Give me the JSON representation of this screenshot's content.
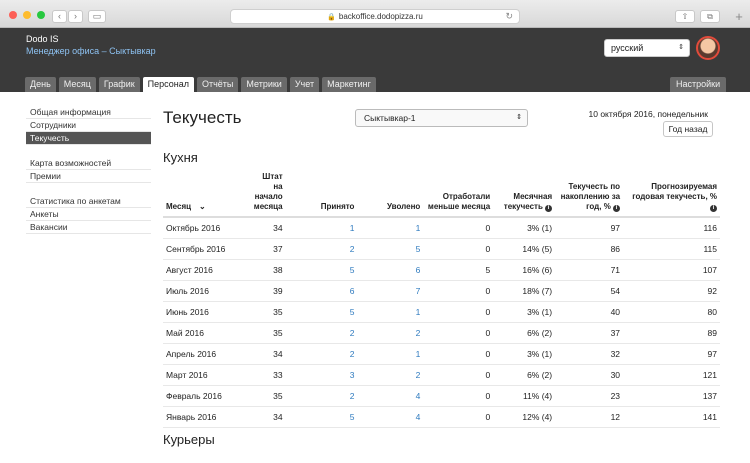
{
  "browser": {
    "url": "backoffice.dodopizza.ru"
  },
  "header": {
    "brand": "Dodo IS",
    "office": "Менеджер офиса – Сыктывкар",
    "language": "русский"
  },
  "tabs": [
    {
      "label": "День"
    },
    {
      "label": "Месяц"
    },
    {
      "label": "График"
    },
    {
      "label": "Персонал",
      "active": true
    },
    {
      "label": "Отчёты"
    },
    {
      "label": "Метрики"
    },
    {
      "label": "Учет"
    },
    {
      "label": "Маркетинг"
    }
  ],
  "settings_label": "Настройки",
  "sidebar": {
    "groups": [
      [
        "Общая информация",
        "Сотрудники",
        "Текучесть"
      ],
      [
        "Карта возможностей",
        "Премии"
      ],
      [
        "Статистика по анкетам",
        "Анкеты",
        "Вакансии"
      ]
    ]
  },
  "main": {
    "title": "Текучесть",
    "city": "Сыктывкар-1",
    "date": "10 октября 2016, понедельник",
    "back_label": "Год назад",
    "section_kitchen": "Кухня",
    "section_couriers": "Курьеры"
  },
  "table": {
    "headers": {
      "month": "Месяц",
      "staff": "Штат на начало месяца",
      "hired": "Принято",
      "fired": "Уволено",
      "worked_less": "Отработали меньше месяца",
      "monthly": "Месячная текучесть",
      "accumulated": "Текучесть по накоплению за год, %",
      "forecast": "Прогнозируемая годовая текучесть, %"
    },
    "rows": [
      {
        "month": "Октябрь 2016",
        "staff": "34",
        "hired": "1",
        "fired": "1",
        "less": "0",
        "monthly": "3% (1)",
        "acc": "97",
        "forecast": "116"
      },
      {
        "month": "Сентябрь 2016",
        "staff": "37",
        "hired": "2",
        "fired": "5",
        "less": "0",
        "monthly": "14% (5)",
        "acc": "86",
        "forecast": "115"
      },
      {
        "month": "Август 2016",
        "staff": "38",
        "hired": "5",
        "fired": "6",
        "less": "5",
        "monthly": "16% (6)",
        "acc": "71",
        "forecast": "107"
      },
      {
        "month": "Июль 2016",
        "staff": "39",
        "hired": "6",
        "fired": "7",
        "less": "0",
        "monthly": "18% (7)",
        "acc": "54",
        "forecast": "92"
      },
      {
        "month": "Июнь 2016",
        "staff": "35",
        "hired": "5",
        "fired": "1",
        "less": "0",
        "monthly": "3% (1)",
        "acc": "40",
        "forecast": "80"
      },
      {
        "month": "Май 2016",
        "staff": "35",
        "hired": "2",
        "fired": "2",
        "less": "0",
        "monthly": "6% (2)",
        "acc": "37",
        "forecast": "89"
      },
      {
        "month": "Апрель 2016",
        "staff": "34",
        "hired": "2",
        "fired": "1",
        "less": "0",
        "monthly": "3% (1)",
        "acc": "32",
        "forecast": "97"
      },
      {
        "month": "Март 2016",
        "staff": "33",
        "hired": "3",
        "fired": "2",
        "less": "0",
        "monthly": "6% (2)",
        "acc": "30",
        "forecast": "121"
      },
      {
        "month": "Февраль 2016",
        "staff": "35",
        "hired": "2",
        "fired": "4",
        "less": "0",
        "monthly": "11% (4)",
        "acc": "23",
        "forecast": "137"
      },
      {
        "month": "Январь 2016",
        "staff": "34",
        "hired": "5",
        "fired": "4",
        "less": "0",
        "monthly": "12% (4)",
        "acc": "12",
        "forecast": "141"
      }
    ]
  }
}
